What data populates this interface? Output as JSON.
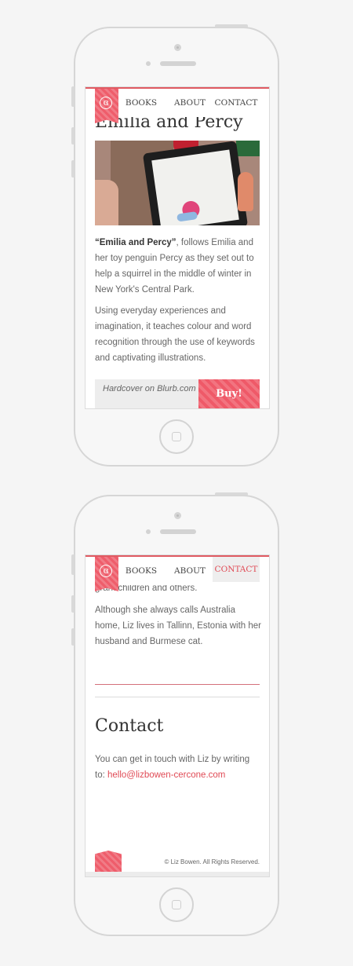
{
  "nav": {
    "books": "BOOKS",
    "about": "ABOUT",
    "contact": "CONTACT"
  },
  "screen1": {
    "peek_title": "Emilia and Percy",
    "para1_bold": "“Emilia and Percy”",
    "para1_rest": ", follows Emilia and her toy penguin Percy as they set out to help a squirrel in the middle of winter in New York's Central Park.",
    "para2": "Using everyday experiences and imagination, it teaches colour and word recognition through the use of keywords and captivating illustrations.",
    "buy_label": "Hardcover on Blurb.com",
    "buy_button": "Buy!"
  },
  "screen2": {
    "peek_text": "grandchildren and others.",
    "para": "Although she always calls Australia home, Liz lives in Tallinn, Estonia with her husband and Burmese cat.",
    "contact_title": "Contact",
    "contact_text": "You can get in touch with Liz by writing to: ",
    "contact_email": "hello@lizbowen-cercone.com",
    "copyright": "© Liz Bowen. All Rights Reserved."
  },
  "colors": {
    "accent": "#e04a55",
    "logo": "#ef5d6b"
  }
}
